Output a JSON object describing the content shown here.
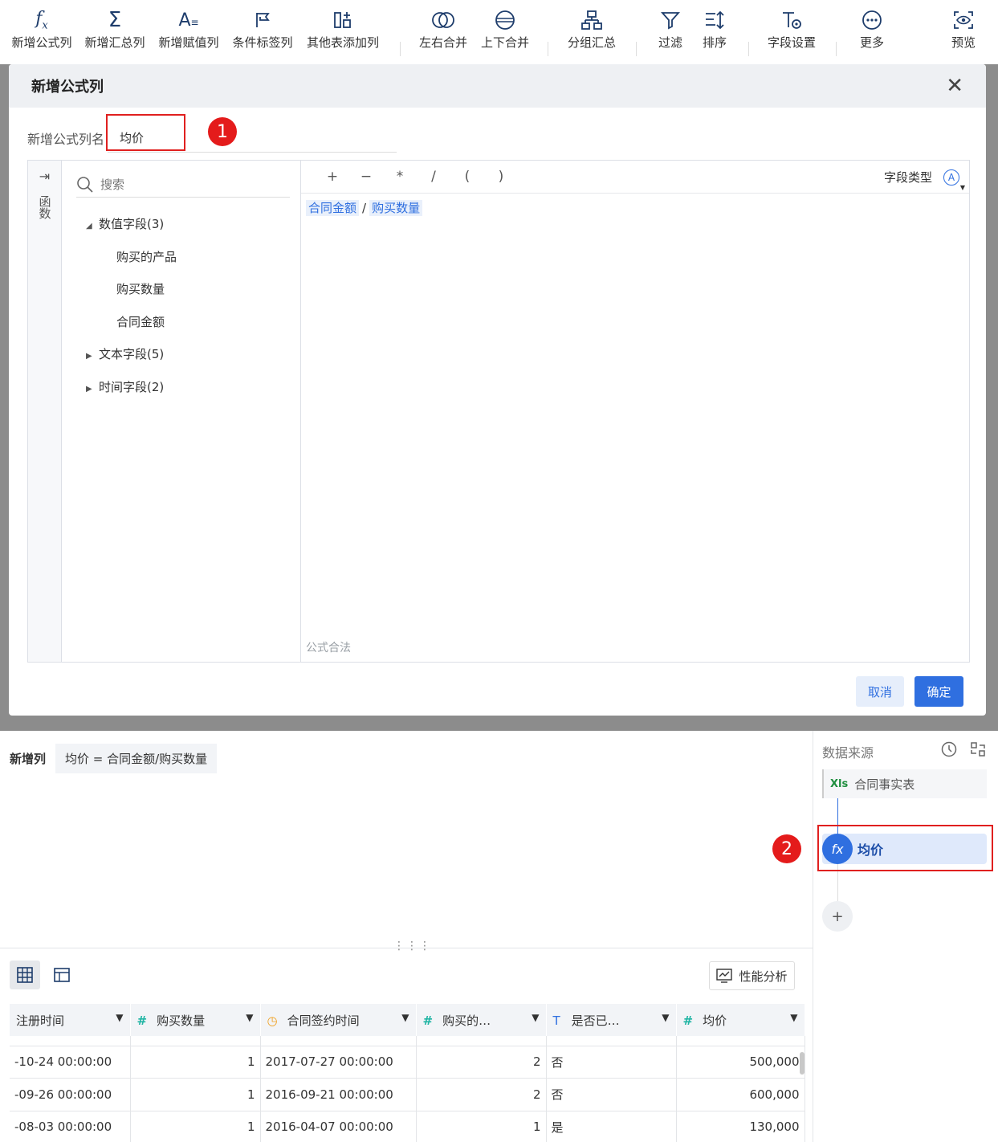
{
  "toolbar": {
    "items": [
      {
        "label": "新增公式列",
        "icon": "fx-icon"
      },
      {
        "label": "新增汇总列",
        "icon": "sigma-icon"
      },
      {
        "label": "新增赋值列",
        "icon": "assign-icon"
      },
      {
        "label": "条件标签列",
        "icon": "flag-icon"
      },
      {
        "label": "其他表添加列",
        "icon": "add-column-icon"
      },
      {
        "label": "左右合并",
        "icon": "merge-horizontal-icon"
      },
      {
        "label": "上下合并",
        "icon": "merge-vertical-icon"
      },
      {
        "label": "分组汇总",
        "icon": "group-icon"
      },
      {
        "label": "过滤",
        "icon": "filter-icon"
      },
      {
        "label": "排序",
        "icon": "sort-icon"
      },
      {
        "label": "字段设置",
        "icon": "field-settings-icon"
      },
      {
        "label": "更多",
        "icon": "more-icon"
      },
      {
        "label": "预览",
        "icon": "preview-icon"
      }
    ]
  },
  "dialog": {
    "title": "新增公式列",
    "name_label": "新增公式列名",
    "name_value": "均价",
    "function_tab": "函数",
    "search_placeholder": "搜索",
    "tree": {
      "numeric_group": "数值字段(3)",
      "numeric_fields": [
        "购买的产品",
        "购买数量",
        "合同金额"
      ],
      "text_group": "文本字段(5)",
      "time_group": "时间字段(2)"
    },
    "operators": [
      "+",
      "−",
      "*",
      "/",
      "(",
      ")"
    ],
    "field_type_label": "字段类型",
    "field_type_icon": "A",
    "formula": {
      "left": "合同金额",
      "op": "/",
      "right": "购买数量"
    },
    "formula_status": "公式合法",
    "cancel_label": "取消",
    "ok_label": "确定"
  },
  "annotations": {
    "badge1": "1",
    "badge2": "2",
    "color": "#e41b1b"
  },
  "new_column": {
    "label": "新增列",
    "expression": "均价 = 合同金额/购买数量"
  },
  "data_source_panel": {
    "title": "数据来源",
    "source_badge": "Xls",
    "source_name": "合同事实表",
    "step_icon": "fx",
    "step_name": "均价",
    "add_label": "+"
  },
  "preview": {
    "perf_button": "性能分析",
    "columns": [
      {
        "label": "注册时间",
        "type": "none"
      },
      {
        "label": "购买数量",
        "type": "number"
      },
      {
        "label": "合同签约时间",
        "type": "time"
      },
      {
        "label": "购买的…",
        "type": "number"
      },
      {
        "label": "是否已…",
        "type": "text"
      },
      {
        "label": "均价",
        "type": "number"
      }
    ],
    "rows": [
      [
        "-10-24 00:00:00",
        "1",
        "2017-07-27 00:00:00",
        "2",
        "否",
        "500,000"
      ],
      [
        "-09-26 00:00:00",
        "1",
        "2016-09-21 00:00:00",
        "2",
        "否",
        "600,000"
      ],
      [
        "-08-03 00:00:00",
        "1",
        "2016-04-07 00:00:00",
        "1",
        "是",
        "130,000"
      ]
    ]
  },
  "colors": {
    "accent": "#2f6fe0",
    "highlight": "#e0201f",
    "number_type": "#20b5a4"
  }
}
